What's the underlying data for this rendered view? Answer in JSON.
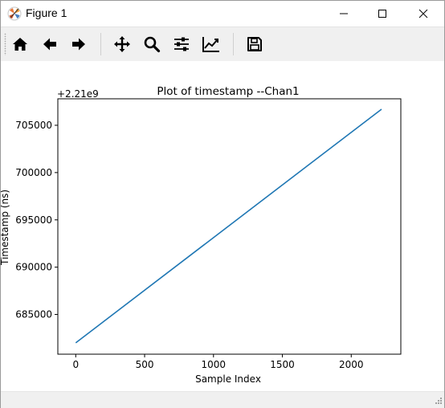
{
  "window": {
    "title": "Figure 1",
    "icon": "matplotlib-logo-icon",
    "controls": [
      "minimize-icon",
      "maximize-icon",
      "close-icon"
    ]
  },
  "toolbar": {
    "buttons": [
      "home-icon",
      "back-arrow-icon",
      "forward-arrow-icon",
      "pan-move-icon",
      "zoom-magnifier-icon",
      "subplots-config-icon",
      "edit-axis-curves-icon",
      "save-floppy-icon"
    ]
  },
  "chart_data": {
    "type": "line",
    "title": "Plot of timestamp --Chan1",
    "xlabel": "Sample Index",
    "ylabel": "Timestamp (ns)",
    "offset_text": "+2.21e9",
    "xlim": [
      -130,
      2360
    ],
    "ylim": [
      680800,
      707800
    ],
    "xticks": [
      0,
      500,
      1000,
      1500,
      2000
    ],
    "yticks": [
      685000,
      690000,
      695000,
      700000,
      705000
    ],
    "xtick_labels": [
      "0",
      "500",
      "1000",
      "1500",
      "2000"
    ],
    "ytick_labels": [
      "685000",
      "690000",
      "695000",
      "700000",
      "705000"
    ],
    "series": [
      {
        "x": [
          0,
          2220
        ],
        "y": [
          682000,
          706700
        ],
        "color": "#1f77b4"
      }
    ],
    "grid": false,
    "legend": false
  }
}
